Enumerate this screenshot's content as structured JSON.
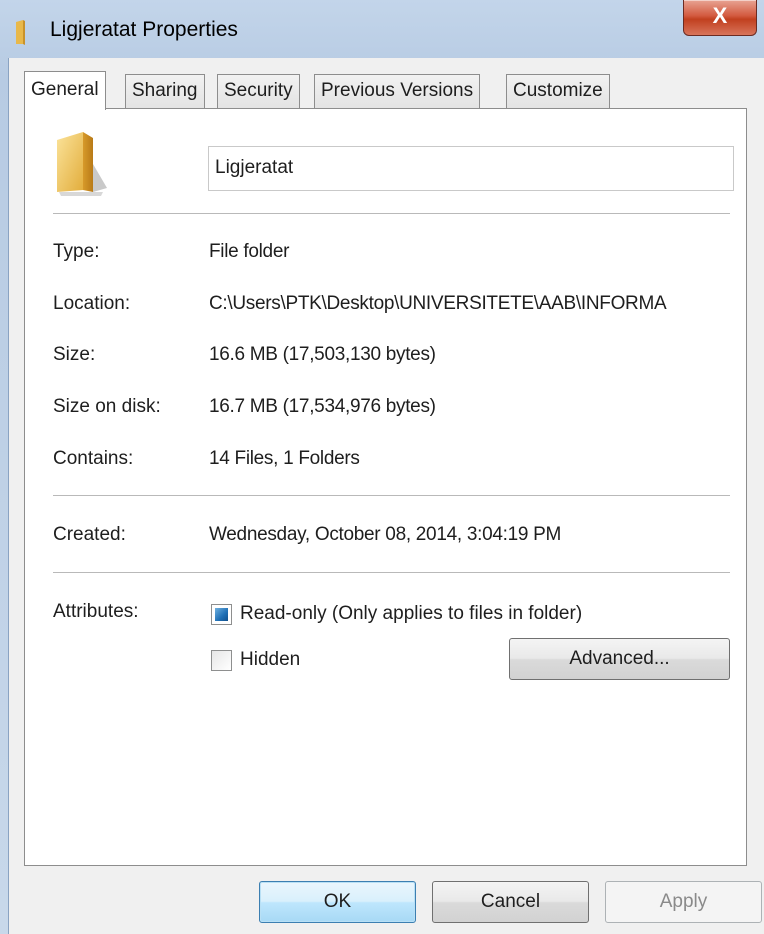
{
  "window": {
    "title": "Ligjeratat Properties",
    "close_label": "X"
  },
  "tabs": [
    {
      "label": "General",
      "active": true
    },
    {
      "label": "Sharing",
      "active": false
    },
    {
      "label": "Security",
      "active": false
    },
    {
      "label": "Previous Versions",
      "active": false
    },
    {
      "label": "Customize",
      "active": false
    }
  ],
  "general": {
    "folder_name": "Ligjeratat",
    "type_label": "Type:",
    "type_value": "File folder",
    "location_label": "Location:",
    "location_value": "C:\\Users\\PTK\\Desktop\\UNIVERSITETE\\AAB\\INFORMA",
    "size_label": "Size:",
    "size_value": "16.6 MB (17,503,130 bytes)",
    "size_on_disk_label": "Size on disk:",
    "size_on_disk_value": "16.7 MB (17,534,976 bytes)",
    "contains_label": "Contains:",
    "contains_value": "14 Files, 1 Folders",
    "created_label": "Created:",
    "created_value": "Wednesday, October 08, 2014, 3:04:19 PM",
    "attributes_label": "Attributes:",
    "readonly_label": "Read-only (Only applies to files in folder)",
    "readonly_state": "indeterminate",
    "hidden_label": "Hidden",
    "hidden_checked": false,
    "advanced_label": "Advanced..."
  },
  "buttons": {
    "ok": "OK",
    "cancel": "Cancel",
    "apply": "Apply"
  },
  "colors": {
    "accent": "#1f6fb5",
    "close_button": "#c1401f",
    "frame": "#b7cbe3"
  }
}
